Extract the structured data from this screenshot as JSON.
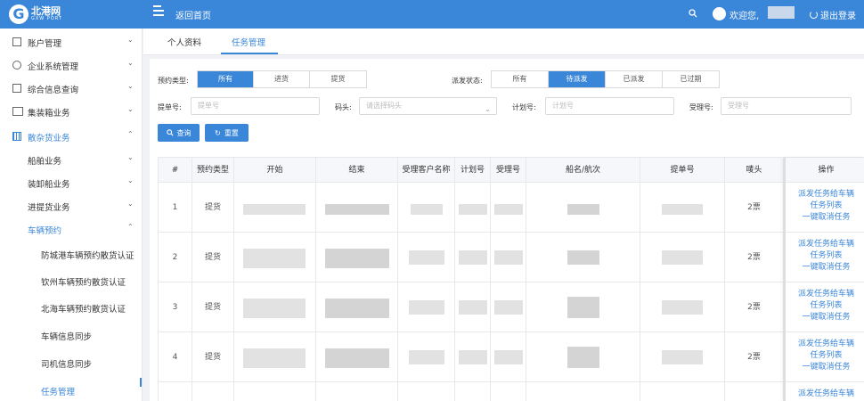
{
  "header": {
    "logo_letter": "G",
    "logo_text": "北港网",
    "logo_sub": "GXW PORT",
    "home_link": "返回首页",
    "greeting": "欢迎您,",
    "logout": "退出登录",
    "bar_color": "#3a86d8"
  },
  "sidebar": {
    "items": [
      {
        "label": "账户管理",
        "icon": "account-icon",
        "chevron": "⌄"
      },
      {
        "label": "企业系统管理",
        "icon": "gear-icon",
        "chevron": "⌄"
      },
      {
        "label": "综合信息查询",
        "icon": "info-icon",
        "chevron": "⌄"
      },
      {
        "label": "集装箱业务",
        "icon": "container-icon",
        "chevron": "⌄"
      },
      {
        "label": "散杂货业务",
        "icon": "bulk-icon",
        "chevron": "⌃"
      }
    ],
    "sub_items": [
      {
        "label": "船舶业务",
        "chevron": "⌄"
      },
      {
        "label": "装卸船业务",
        "chevron": "⌄"
      },
      {
        "label": "进提货业务",
        "chevron": "⌄"
      },
      {
        "label": "车辆预约",
        "chevron": "⌃"
      }
    ],
    "sub2_items": [
      {
        "label": "防城港车辆预约散货认证"
      },
      {
        "label": "钦州车辆预约散货认证"
      },
      {
        "label": "北海车辆预约散货认证"
      },
      {
        "label": "车辆信息同步"
      },
      {
        "label": "司机信息同步"
      },
      {
        "label": "任务管理"
      }
    ]
  },
  "tabs": [
    {
      "label": "个人资料"
    },
    {
      "label": "任务管理"
    }
  ],
  "filters": {
    "booking_type_label": "预约类型:",
    "booking_type_options": [
      "所有",
      "进货",
      "提货"
    ],
    "dispatch_status_label": "派发状态:",
    "dispatch_status_options": [
      "所有",
      "待派发",
      "已派发",
      "已过期"
    ],
    "bill_no_label": "提单号:",
    "bill_no_placeholder": "提单号",
    "terminal_label": "码头:",
    "terminal_placeholder": "请选择码头",
    "plan_no_label": "计划号:",
    "plan_no_placeholder": "计划号",
    "accept_no_label": "受理号:",
    "accept_no_placeholder": "受理号",
    "search_button": "查询",
    "reset_button": "重置"
  },
  "table": {
    "headers": [
      "#",
      "预约类型",
      "开始",
      "结束",
      "受理客户名称",
      "计划号",
      "受理号",
      "船名/航次",
      "提单号",
      "唛头",
      "操作"
    ],
    "rows": [
      {
        "index": "1",
        "type": "提货",
        "marks": "2票"
      },
      {
        "index": "2",
        "type": "提货",
        "marks": "2票"
      },
      {
        "index": "3",
        "type": "提货",
        "marks": "2票"
      },
      {
        "index": "4",
        "type": "提货",
        "marks": "2票"
      },
      {
        "index": "",
        "type": "",
        "marks": ""
      }
    ],
    "actions": [
      "派发任务给车辆",
      "任务列表",
      "一键取消任务"
    ]
  }
}
